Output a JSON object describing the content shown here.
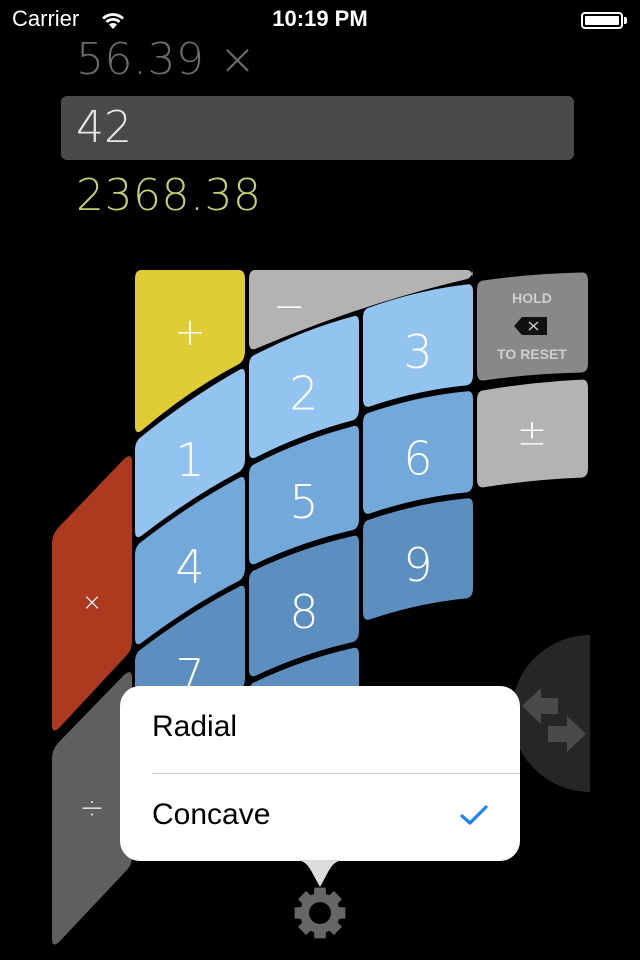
{
  "status_bar": {
    "carrier": "Carrier",
    "time": "10:19 PM",
    "wifi_icon": "wifi-icon",
    "battery_icon": "battery-full-icon"
  },
  "display": {
    "previous_operand": "56.39 ×",
    "current_input": "42",
    "result": "2368.38",
    "result_color": "#c3cf72"
  },
  "keypad": {
    "layout": "Concave",
    "operators": {
      "add": "+",
      "subtract": "−",
      "multiply": "×",
      "divide": "÷",
      "negate": "±"
    },
    "backspace": {
      "top_label": "HOLD",
      "bottom_label": "TO RESET",
      "icon": "backspace-icon"
    },
    "digits": [
      "1",
      "2",
      "3",
      "4",
      "5",
      "6",
      "7",
      "8",
      "9"
    ],
    "colors": {
      "add": "#e0cd35",
      "subtract": "#b3b3b3",
      "multiply": "#ad3a1f",
      "divide": "#5f5f5f",
      "backspace": "#888888",
      "negate": "#b3b3b3",
      "row1": "#93c3ef",
      "row2": "#72a8da",
      "row3": "#5c8fbf"
    }
  },
  "swap_button": {
    "icon": "swap-arrows-icon"
  },
  "layout_menu": {
    "options": [
      {
        "label": "Radial",
        "selected": false
      },
      {
        "label": "Concave",
        "selected": true
      }
    ],
    "check_color": "#1a82fb"
  },
  "settings_button": {
    "icon": "gear-icon"
  }
}
